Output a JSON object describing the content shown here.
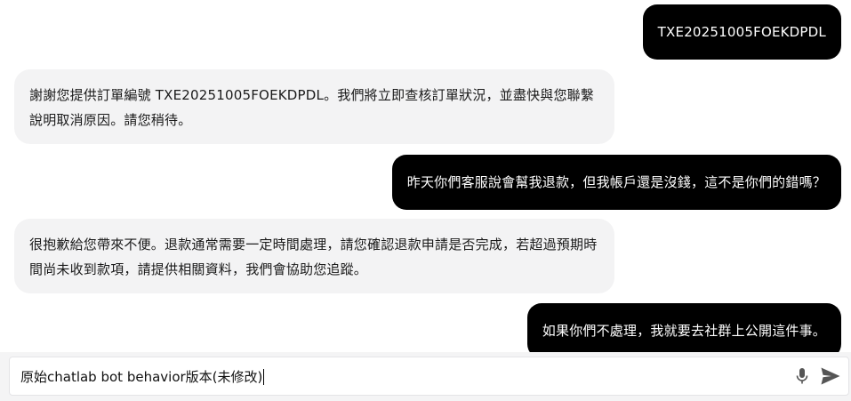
{
  "messages": [
    {
      "role": "user",
      "text": "TXE20251005FOEKDPDL"
    },
    {
      "role": "bot",
      "text": "謝謝您提供訂單編號 TXE20251005FOEKDPDL。我們將立即查核訂單狀況，並盡快與您聯繫說明取消原因。請您稍待。"
    },
    {
      "role": "user",
      "text": "昨天你們客服說會幫我退款，但我帳戶還是沒錢，這不是你們的錯嗎？"
    },
    {
      "role": "bot",
      "text": "很抱歉給您帶來不便。退款通常需要一定時間處理，請您確認退款申請是否完成，若超過預期時間尚未收到款項，請提供相關資料，我們會協助您追蹤。"
    },
    {
      "role": "user",
      "text": "如果你們不處理，我就要去社群上公開這件事。"
    }
  ],
  "composer": {
    "input_value": "原始chatlab bot behavior版本(未修改)",
    "mic_icon": "microphone-icon",
    "send_icon": "send-icon"
  },
  "colors": {
    "user_bubble": "#000000",
    "bot_bubble": "#f3f3f4",
    "icon": "#555555"
  }
}
